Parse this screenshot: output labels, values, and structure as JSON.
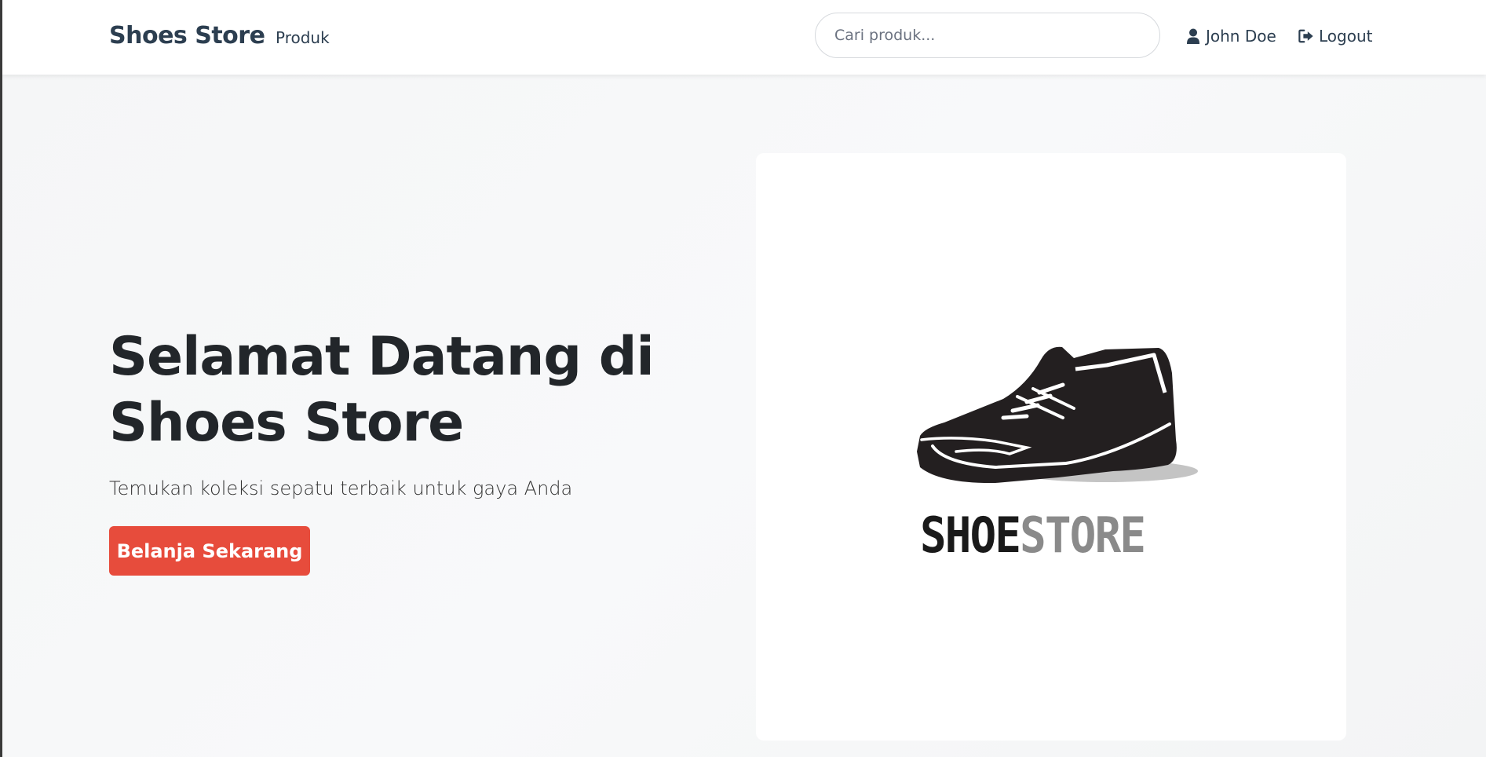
{
  "navbar": {
    "brand": "Shoes Store",
    "nav_link": "Produk",
    "search_placeholder": "Cari produk...",
    "user_name": "John Doe",
    "logout_label": "Logout"
  },
  "hero": {
    "title_line1": "Selamat Datang di",
    "title_line2": "Shoes Store",
    "subtitle": "Temukan koleksi sepatu terbaik untuk gaya Anda",
    "cta_label": "Belanja Sekarang"
  },
  "logo": {
    "word_dark": "SHOE",
    "word_gray": "STORE"
  },
  "colors": {
    "accent": "#e74c3c",
    "brand": "#2c3e50"
  },
  "icons": {
    "user": "user-icon",
    "logout": "logout-icon",
    "shoe": "shoe-logo-icon"
  }
}
